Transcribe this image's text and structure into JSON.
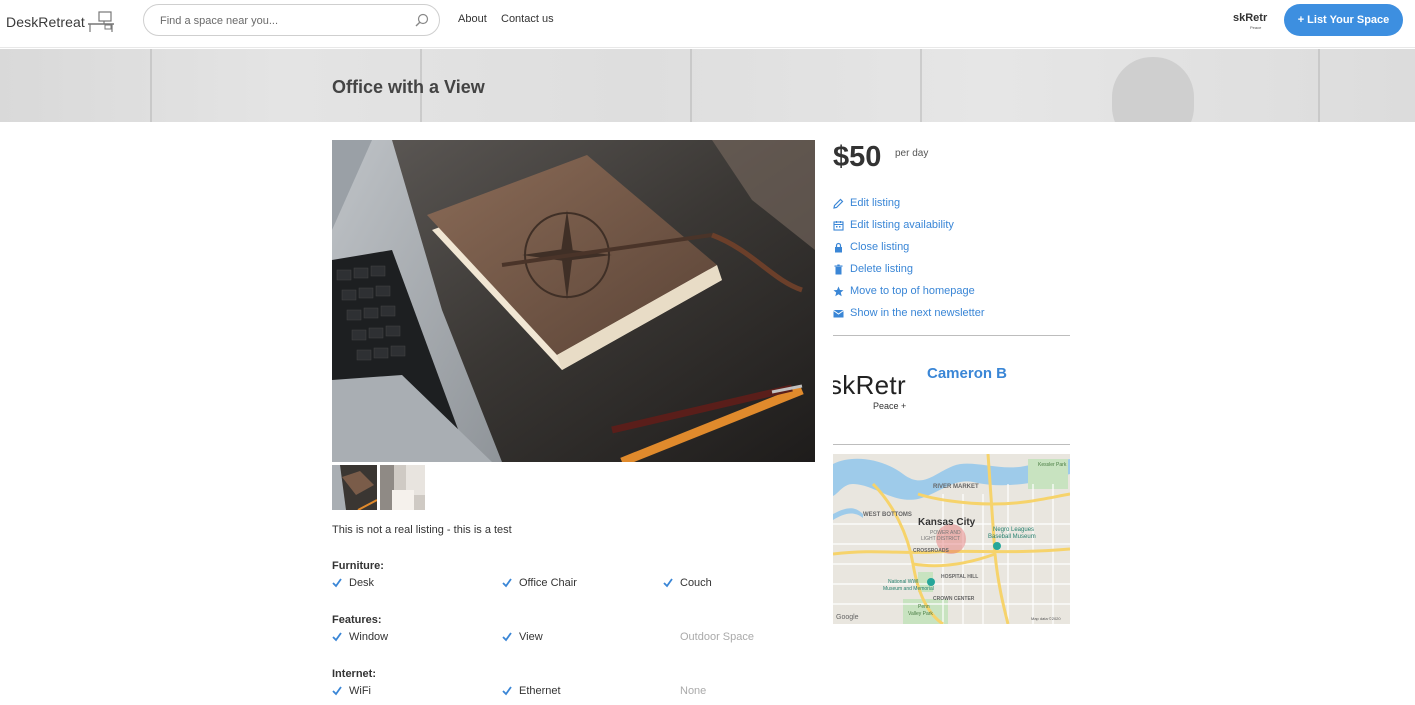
{
  "header": {
    "logo_text": "DeskRetreat",
    "search_placeholder": "Find a space near you...",
    "nav": {
      "about": "About",
      "contact": "Contact us"
    },
    "avatar_text": "skRetr",
    "avatar_sub": "Peace",
    "list_button": "+ List Your Space"
  },
  "listing": {
    "title": "Office with a View",
    "description": "This is not a real listing - this is a test",
    "price": "$50",
    "price_unit": "per day"
  },
  "actions": [
    {
      "label": "Edit listing",
      "icon": "pencil-icon"
    },
    {
      "label": "Edit listing availability",
      "icon": "calendar-icon"
    },
    {
      "label": "Close listing",
      "icon": "lock-icon"
    },
    {
      "label": "Delete listing",
      "icon": "trash-icon"
    },
    {
      "label": "Move to top of homepage",
      "icon": "star-icon"
    },
    {
      "label": "Show in the next newsletter",
      "icon": "envelope-icon"
    }
  ],
  "host": {
    "logo_text": "skRetr",
    "logo_sub": "Peace +",
    "name": "Cameron B"
  },
  "amenities": {
    "furniture": {
      "title": "Furniture:",
      "items": [
        {
          "label": "Desk",
          "checked": true
        },
        {
          "label": "Office Chair",
          "checked": true
        },
        {
          "label": "Couch",
          "checked": true
        }
      ]
    },
    "features": {
      "title": "Features:",
      "items": [
        {
          "label": "Window",
          "checked": true
        },
        {
          "label": "View",
          "checked": true
        },
        {
          "label": "Outdoor Space",
          "checked": false
        }
      ]
    },
    "internet": {
      "title": "Internet:",
      "items": [
        {
          "label": "WiFi",
          "checked": true
        },
        {
          "label": "Ethernet",
          "checked": true
        },
        {
          "label": "None",
          "checked": false
        }
      ]
    }
  },
  "map": {
    "labels": {
      "river_market": "RIVER MARKET",
      "west_bottoms": "WEST BOTTOMS",
      "city": "Kansas City",
      "power_light_1": "POWER AND",
      "power_light_2": "LIGHT DISTRICT",
      "crossroads": "CROSSROADS",
      "hospital_hill": "HOSPITAL HILL",
      "crown_center": "CROWN CENTER",
      "negro_leagues_1": "Negro Leagues",
      "negro_leagues_2": "Baseball Museum",
      "wwi_1": "National WWI",
      "wwi_2": "Museum and Memorial",
      "penn_valley_1": "Penn",
      "penn_valley_2": "Valley Park",
      "kessler": "Kessler Park",
      "google": "Google",
      "map_data": "Map data ©2020"
    }
  },
  "colors": {
    "accent": "#3d8fe0",
    "link": "#3a86d6",
    "check": "#3a86d6"
  }
}
